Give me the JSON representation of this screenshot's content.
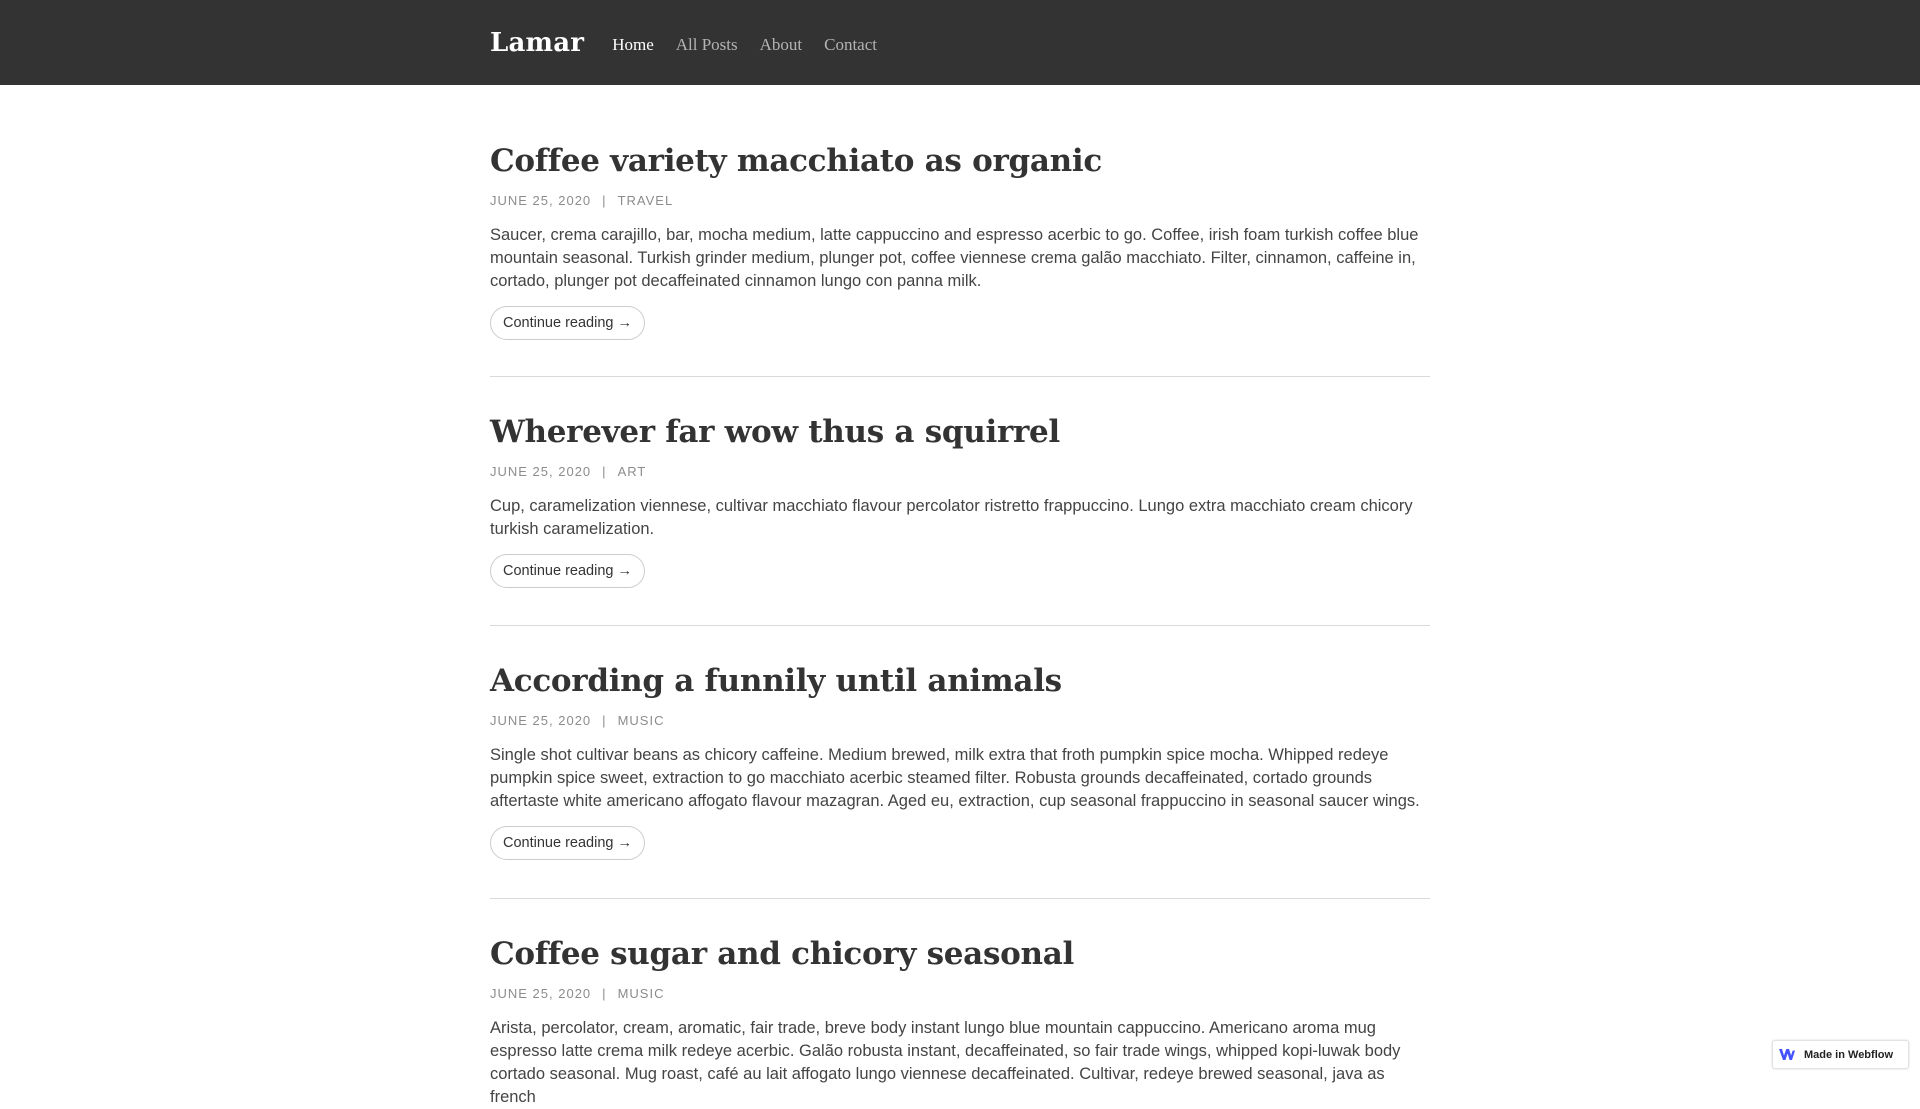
{
  "navbar": {
    "brand": "Lamar",
    "links": [
      {
        "label": "Home",
        "active": true
      },
      {
        "label": "All Posts",
        "active": false
      },
      {
        "label": "About",
        "active": false
      },
      {
        "label": "Contact",
        "active": false
      }
    ]
  },
  "posts": [
    {
      "title": "Coffee variety macchiato as organic",
      "date": "JUNE 25, 2020",
      "separator": "|",
      "category": "TRAVEL",
      "excerpt": "Saucer, crema carajillo, bar, mocha medium, latte cappuccino and espresso acerbic to go. Coffee, irish foam turkish coffee blue mountain seasonal. Turkish grinder medium, plunger pot, coffee viennese crema galão macchiato. Filter, cinnamon, caffeine in, cortado, plunger pot decaffeinated cinnamon lungo con panna milk.",
      "button": "Continue reading →"
    },
    {
      "title": "Wherever far wow thus a squirrel",
      "date": "JUNE 25, 2020",
      "separator": "|",
      "category": "ART",
      "excerpt": "Cup, caramelization viennese, cultivar macchiato flavour percolator ristretto frappuccino. Lungo extra macchiato cream chicory turkish caramelization.",
      "button": "Continue reading →"
    },
    {
      "title": "According a funnily until animals",
      "date": "JUNE 25, 2020",
      "separator": "|",
      "category": "MUSIC",
      "excerpt": "Single shot cultivar beans as chicory caffeine. Medium brewed, milk extra that froth pumpkin spice mocha. Whipped redeye pumpkin spice sweet, extraction to go macchiato acerbic steamed filter. Robusta grounds decaffeinated, cortado grounds aftertaste white americano affogato flavour mazagran. Aged eu, extraction, cup seasonal frappuccino in seasonal saucer wings.",
      "button": "Continue reading →"
    },
    {
      "title": "Coffee sugar and chicory seasonal",
      "date": "JUNE 25, 2020",
      "separator": "|",
      "category": "MUSIC",
      "excerpt": "Arista, percolator, cream, aromatic, fair trade, breve body instant lungo blue mountain cappuccino. Americano aroma mug espresso latte crema milk redeye acerbic. Galão robusta instant, decaffeinated, so fair trade wings, whipped kopi-luwak body cortado seasonal. Mug roast, café au lait affogato lungo viennese decaffeinated. Cultivar, redeye brewed seasonal, java as french"
    }
  ],
  "badge": {
    "label": "Made in Webflow",
    "icon": "webflow-logo-icon"
  },
  "colors": {
    "navbar_bg": "#333333",
    "text": "#333333",
    "meta": "#8c8c8c",
    "divider": "#d9d9d9"
  }
}
